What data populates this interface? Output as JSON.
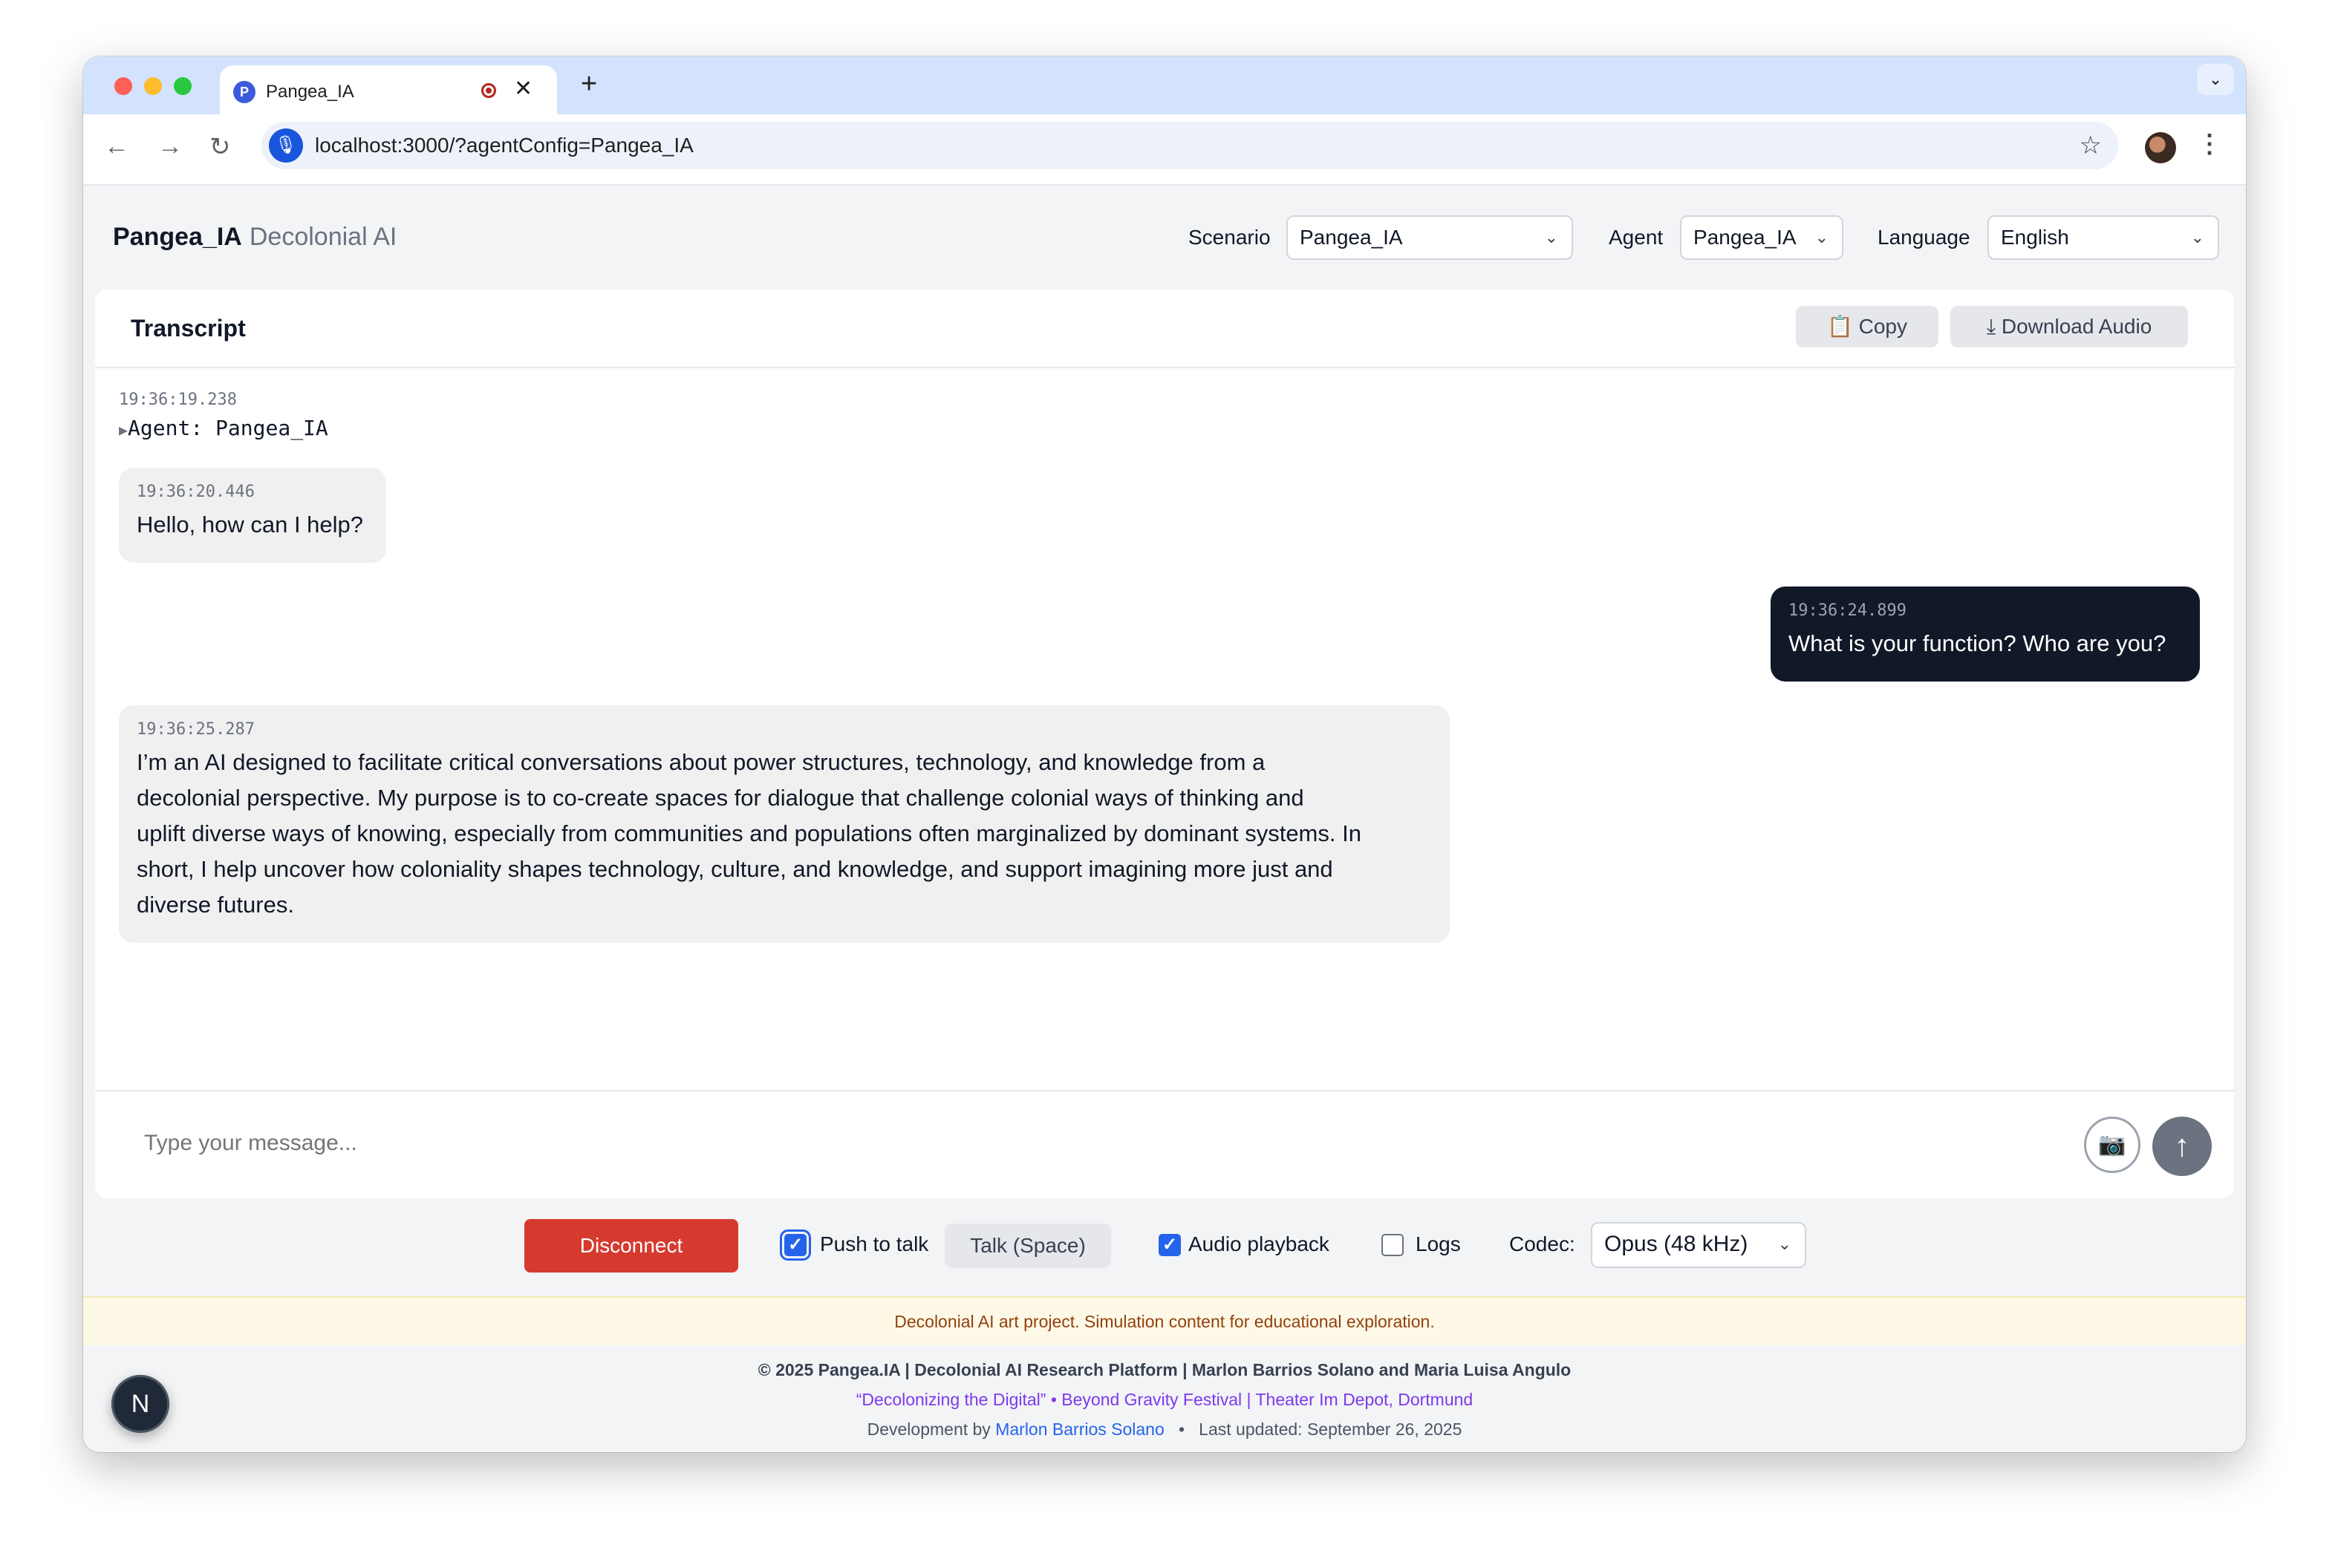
{
  "browser": {
    "tab_title": "Pangea_IA",
    "tab_favicon_letter": "P",
    "url": "localhost:3000/?agentConfig=Pangea_IA",
    "icons": {
      "back": "←",
      "forward": "→",
      "reload": "↻",
      "star": "☆",
      "menu": "⋮",
      "close": "✕",
      "new_tab": "+",
      "tab_menu": "⌄",
      "mic": "🎙"
    },
    "traffic_colors": [
      "#ff5f57",
      "#febc2e",
      "#28c840"
    ]
  },
  "header": {
    "app_name": "Pangea_IA",
    "app_subtitle": "Decolonial AI",
    "scenario_label": "Scenario",
    "scenario_value": "Pangea_IA",
    "agent_label": "Agent",
    "agent_value": "Pangea_IA",
    "language_label": "Language",
    "language_value": "English"
  },
  "transcript": {
    "title": "Transcript",
    "copy_label": "Copy",
    "download_label": "Download Audio",
    "log": {
      "timestamp": "19:36:19.238",
      "text": "Agent: Pangea_IA"
    },
    "messages": [
      {
        "role": "agent",
        "timestamp": "19:36:20.446",
        "text": "Hello, how can I help?"
      },
      {
        "role": "user",
        "timestamp": "19:36:24.899",
        "text": "What is your function? Who are you?"
      },
      {
        "role": "agent",
        "timestamp": "19:36:25.287",
        "lines": [
          "I’m an AI designed to facilitate critical conversations about power structures, technology, and knowledge from a",
          "decolonial perspective. My purpose is to co-create spaces for dialogue that challenge colonial ways of thinking and",
          "uplift diverse ways of knowing, especially from communities and populations often marginalized by dominant systems. In",
          "short, I help uncover how coloniality shapes technology, culture, and knowledge, and support imagining more just and",
          "diverse futures."
        ]
      }
    ],
    "input_placeholder": "Type your message..."
  },
  "controls": {
    "disconnect_label": "Disconnect",
    "push_to_talk_label": "Push to talk",
    "push_to_talk_checked": true,
    "talk_label": "Talk (Space)",
    "audio_playback_label": "Audio playback",
    "audio_playback_checked": true,
    "logs_label": "Logs",
    "logs_checked": false,
    "codec_label": "Codec:",
    "codec_value": "Opus (48 kHz)"
  },
  "notice": "Decolonial AI art project. Simulation content for educational exploration.",
  "footer": {
    "line1": "© 2025 Pangea.IA | Decolonial AI Research Platform | Marlon Barrios Solano and Maria Luisa Angulo",
    "line2": "“Decolonizing the Digital” • Beyond Gravity Festival | Theater Im Depot, Dortmund",
    "dev_prefix": "Development by",
    "dev_name": "Marlon Barrios Solano",
    "separator": "•",
    "updated": "Last updated: September 26, 2025"
  },
  "dev_badge": "N",
  "colors": {
    "accent": "#2563eb",
    "danger": "#d63a2f",
    "user_bubble": "#111827",
    "agent_bubble": "#f0f0f0"
  }
}
